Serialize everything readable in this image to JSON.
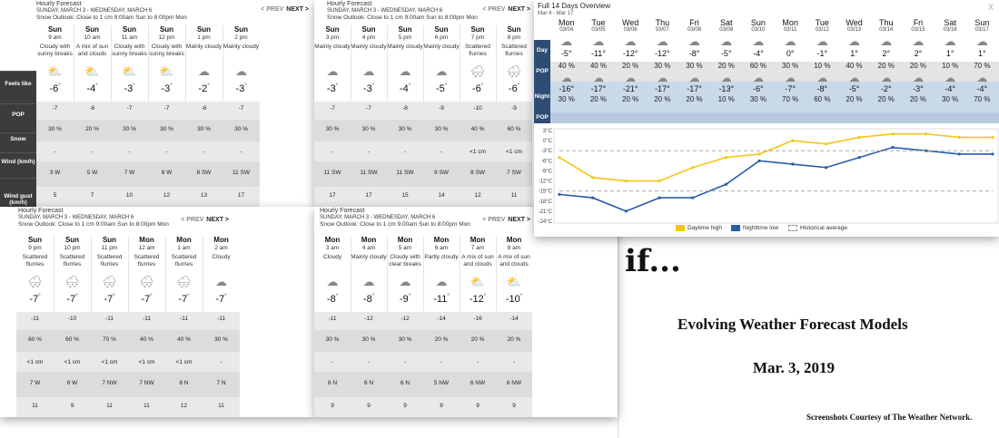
{
  "panels": [
    {
      "title": "Hourly Forecast",
      "dates": "SUNDAY, MARCH 3 - WEDNESDAY, MARCH 6",
      "outlook": "Snow Outlook: Close to 1 cm 9:00am Sun to 8:00pm Mon",
      "prev": "< PREV",
      "next": "NEXT >",
      "labels": [
        "Feels like",
        "POP",
        "Snow",
        "Wind (km/h)",
        "Wind gust (km/h)"
      ],
      "columns": [
        {
          "day": "Sun",
          "time": "9 am",
          "cond": "Cloudy with sunny breaks",
          "icon": "sun-cloud-icon",
          "temp": "-6",
          "feels": "-7",
          "pop": "30 %",
          "snow": "-",
          "wind": "3 W",
          "gust": "5"
        },
        {
          "day": "Sun",
          "time": "10 am",
          "cond": "A mix of sun and clouds",
          "icon": "sun-cloud-icon",
          "temp": "-4",
          "feels": "-6",
          "pop": "20 %",
          "snow": "-",
          "wind": "5 W",
          "gust": "7"
        },
        {
          "day": "Sun",
          "time": "11 am",
          "cond": "Cloudy with sunny breaks",
          "icon": "sun-cloud-icon",
          "temp": "-3",
          "feels": "-7",
          "pop": "30 %",
          "snow": "-",
          "wind": "7 W",
          "gust": "10"
        },
        {
          "day": "Sun",
          "time": "12 pm",
          "cond": "Cloudy with sunny breaks",
          "icon": "sun-cloud-icon",
          "temp": "-3",
          "feels": "-7",
          "pop": "30 %",
          "snow": "-",
          "wind": "8 W",
          "gust": "12"
        },
        {
          "day": "Sun",
          "time": "1 pm",
          "cond": "Mainly cloudy",
          "icon": "cloud-icon",
          "temp": "-2",
          "feels": "-6",
          "pop": "30 %",
          "snow": "-",
          "wind": "8 SW",
          "gust": "13"
        },
        {
          "day": "Sun",
          "time": "2 pm",
          "cond": "Mainly cloudy",
          "icon": "cloud-icon",
          "temp": "-3",
          "feels": "-7",
          "pop": "30 %",
          "snow": "-",
          "wind": "11 SW",
          "gust": "17"
        }
      ]
    },
    {
      "title": "Hourly Forecast",
      "dates": "SUNDAY, MARCH 3 - WEDNESDAY, MARCH 6",
      "outlook": "Snow Outlook: Close to 1 cm 9:00am Sun to 8:00pm Mon",
      "prev": "< PREV",
      "next": "NEXT >",
      "columns": [
        {
          "day": "Sun",
          "time": "3 pm",
          "cond": "Mainly cloudy",
          "icon": "cloud-icon",
          "temp": "-3",
          "feels": "-7",
          "pop": "30 %",
          "snow": "-",
          "wind": "11 SW",
          "gust": "17"
        },
        {
          "day": "Sun",
          "time": "4 pm",
          "cond": "Mainly cloudy",
          "icon": "cloud-icon",
          "temp": "-3",
          "feels": "-7",
          "pop": "30 %",
          "snow": "-",
          "wind": "11 SW",
          "gust": "17"
        },
        {
          "day": "Sun",
          "time": "5 pm",
          "cond": "Mainly cloudy",
          "icon": "cloud-icon",
          "temp": "-4",
          "feels": "-8",
          "pop": "30 %",
          "snow": "-",
          "wind": "11 SW",
          "gust": "15"
        },
        {
          "day": "Sun",
          "time": "6 pm",
          "cond": "Mainly cloudy",
          "icon": "cloud-icon",
          "temp": "-5",
          "feels": "-9",
          "pop": "30 %",
          "snow": "-",
          "wind": "9 SW",
          "gust": "14"
        },
        {
          "day": "Sun",
          "time": "7 pm",
          "cond": "Scattered flurries",
          "icon": "snow-cloud-icon",
          "temp": "-6",
          "feels": "-10",
          "pop": "40 %",
          "snow": "<1 cm",
          "wind": "8 SW",
          "gust": "12"
        },
        {
          "day": "Sun",
          "time": "8 pm",
          "cond": "Scattered flurries",
          "icon": "snow-cloud-icon",
          "temp": "-6",
          "feels": "-9",
          "pop": "60 %",
          "snow": "<1 cm",
          "wind": "7 SW",
          "gust": "11"
        }
      ]
    },
    {
      "title": "Hourly Forecast",
      "dates": "SUNDAY, MARCH 3 - WEDNESDAY, MARCH 6",
      "outlook": "Snow Outlook: Close to 1 cm 9:00am Sun to 8:00pm Mon",
      "prev": "< PREV",
      "next": "NEXT >",
      "columns": [
        {
          "day": "Sun",
          "time": "9 pm",
          "cond": "Scattered flurries",
          "icon": "snow-cloud-icon",
          "temp": "-7",
          "feels": "-11",
          "pop": "60 %",
          "snow": "<1 cm",
          "wind": "7 W",
          "gust": "11"
        },
        {
          "day": "Sun",
          "time": "10 pm",
          "cond": "Scattered flurries",
          "icon": "snow-cloud-icon",
          "temp": "-7",
          "feels": "-10",
          "pop": "60 %",
          "snow": "<1 cm",
          "wind": "6 W",
          "gust": "9"
        },
        {
          "day": "Sun",
          "time": "11 pm",
          "cond": "Scattered flurries",
          "icon": "snow-cloud-icon",
          "temp": "-7",
          "feels": "-11",
          "pop": "70 %",
          "snow": "<1 cm",
          "wind": "7 NW",
          "gust": "11"
        },
        {
          "day": "Mon",
          "time": "12 am",
          "cond": "Scattered flurries",
          "icon": "snow-cloud-icon",
          "temp": "-7",
          "feels": "-11",
          "pop": "40 %",
          "snow": "<1 cm",
          "wind": "7 NW",
          "gust": "11"
        },
        {
          "day": "Mon",
          "time": "1 am",
          "cond": "Scattered flurries",
          "icon": "snow-cloud-icon",
          "temp": "-7",
          "feels": "-11",
          "pop": "40 %",
          "snow": "<1 cm",
          "wind": "8 N",
          "gust": "12"
        },
        {
          "day": "Mon",
          "time": "2 am",
          "cond": "Cloudy",
          "icon": "cloud-icon",
          "temp": "-7",
          "feels": "-11",
          "pop": "30 %",
          "snow": "-",
          "wind": "7 N",
          "gust": "11"
        }
      ]
    },
    {
      "title": "Hourly Forecast",
      "dates": "SUNDAY, MARCH 3 - WEDNESDAY, MARCH 6",
      "outlook": "Snow Outlook: Close to 1 cm 9:00am Sun to 8:00pm Mon",
      "prev": "< PREV",
      "next": "NEXT >",
      "columns": [
        {
          "day": "Mon",
          "time": "3 am",
          "cond": "Cloudy",
          "icon": "cloud-icon",
          "temp": "-8",
          "feels": "-11",
          "pop": "30 %",
          "snow": "-",
          "wind": "6 N",
          "gust": "9"
        },
        {
          "day": "Mon",
          "time": "4 am",
          "cond": "Mainly cloudy",
          "icon": "cloud-icon",
          "temp": "-8",
          "feels": "-12",
          "pop": "30 %",
          "snow": "-",
          "wind": "6 N",
          "gust": "9"
        },
        {
          "day": "Mon",
          "time": "5 am",
          "cond": "Cloudy with clear breaks",
          "icon": "moon-cloud-icon",
          "temp": "-9",
          "feels": "-12",
          "pop": "30 %",
          "snow": "-",
          "wind": "6 N",
          "gust": "9"
        },
        {
          "day": "Mon",
          "time": "6 am",
          "cond": "Partly cloudy",
          "icon": "moon-cloud-icon",
          "temp": "-11",
          "feels": "-14",
          "pop": "20 %",
          "snow": "-",
          "wind": "5 NW",
          "gust": "8"
        },
        {
          "day": "Mon",
          "time": "7 am",
          "cond": "A mix of sun and clouds",
          "icon": "sun-cloud-icon",
          "temp": "-12",
          "feels": "-16",
          "pop": "20 %",
          "snow": "-",
          "wind": "6 NW",
          "gust": "9"
        },
        {
          "day": "Mon",
          "time": "8 am",
          "cond": "A mix of sun and clouds",
          "icon": "sun-cloud-icon",
          "temp": "-10",
          "feels": "-14",
          "pop": "20 %",
          "snow": "-",
          "wind": "6 NW",
          "gust": "9"
        }
      ]
    }
  ],
  "overview": {
    "title": "Full 14 Days Overview",
    "range": "Mar 4 - Mar 17",
    "close": "X",
    "labels": {
      "day": "Day",
      "pop": "POP",
      "night": "Night",
      "npop": "POP"
    },
    "days": [
      {
        "day": "Mon",
        "date": "03/04",
        "dtemp": "-5",
        "dpop": "40 %",
        "ntemp": "-16",
        "npop": "30 %"
      },
      {
        "day": "Tue",
        "date": "03/05",
        "dtemp": "-11",
        "dpop": "40 %",
        "ntemp": "-17",
        "npop": "20 %"
      },
      {
        "day": "Wed",
        "date": "03/06",
        "dtemp": "-12",
        "dpop": "20 %",
        "ntemp": "-21",
        "npop": "20 %"
      },
      {
        "day": "Thu",
        "date": "03/07",
        "dtemp": "-12",
        "dpop": "30 %",
        "ntemp": "-17",
        "npop": "20 %"
      },
      {
        "day": "Fri",
        "date": "03/08",
        "dtemp": "-8",
        "dpop": "30 %",
        "ntemp": "-17",
        "npop": "20 %"
      },
      {
        "day": "Sat",
        "date": "03/09",
        "dtemp": "-5",
        "dpop": "20 %",
        "ntemp": "-13",
        "npop": "10 %"
      },
      {
        "day": "Sun",
        "date": "03/10",
        "dtemp": "-4",
        "dpop": "60 %",
        "ntemp": "-6",
        "npop": "30 %"
      },
      {
        "day": "Mon",
        "date": "03/11",
        "dtemp": "0",
        "dpop": "30 %",
        "ntemp": "-7",
        "npop": "70 %"
      },
      {
        "day": "Tue",
        "date": "03/12",
        "dtemp": "-1",
        "dpop": "10 %",
        "ntemp": "-8",
        "npop": "60 %"
      },
      {
        "day": "Wed",
        "date": "03/13",
        "dtemp": "1",
        "dpop": "40 %",
        "ntemp": "-5",
        "npop": "20 %"
      },
      {
        "day": "Thu",
        "date": "03/14",
        "dtemp": "2",
        "dpop": "20 %",
        "ntemp": "-2",
        "npop": "20 %"
      },
      {
        "day": "Fri",
        "date": "03/15",
        "dtemp": "2",
        "dpop": "20 %",
        "ntemp": "-3",
        "npop": "20 %"
      },
      {
        "day": "Sat",
        "date": "03/16",
        "dtemp": "1",
        "dpop": "10 %",
        "ntemp": "-4",
        "npop": "30 %"
      },
      {
        "day": "Sun",
        "date": "03/17",
        "dtemp": "1",
        "dpop": "70 %",
        "ntemp": "-4",
        "npop": "70 %"
      }
    ],
    "chart_data": {
      "type": "line",
      "x": [
        "03/04",
        "03/05",
        "03/06",
        "03/07",
        "03/08",
        "03/09",
        "03/10",
        "03/11",
        "03/12",
        "03/13",
        "03/14",
        "03/15",
        "03/16",
        "03/17"
      ],
      "series": [
        {
          "name": "Daytime high",
          "color": "#f5c518",
          "values": [
            -5,
            -11,
            -12,
            -12,
            -8,
            -5,
            -4,
            0,
            -1,
            1,
            2,
            2,
            1,
            1
          ]
        },
        {
          "name": "Nighttime low",
          "color": "#2a5da8",
          "values": [
            -16,
            -17,
            -21,
            -17,
            -17,
            -13,
            -6,
            -7,
            -8,
            -5,
            -2,
            -3,
            -4,
            -4
          ]
        },
        {
          "name": "Historical average",
          "color": "#aaaaaa",
          "values": [
            -3,
            -3,
            -3,
            -3,
            -3,
            -3,
            -3,
            -3,
            -3,
            -3,
            -3,
            -3,
            -3,
            -3
          ]
        },
        {
          "color": "#aaaaaa",
          "values": [
            -15,
            -15,
            -15,
            -15,
            -15,
            -15,
            -15,
            -15,
            -15,
            -15,
            -15,
            -15,
            -15,
            -15
          ]
        }
      ],
      "yticks": [
        "3°C",
        "0°C",
        "-3°C",
        "-6°C",
        "-9°C",
        "-12°C",
        "-15°C",
        "-18°C",
        "-21°C",
        "-24°C"
      ],
      "ylim": [
        -24,
        3
      ]
    }
  },
  "slide": {
    "if_text": "if...",
    "title": "Evolving Weather Forecast Models",
    "date": "Mar. 3, 2019",
    "credit": "Screenshots Courtesy of The Weather Network."
  }
}
